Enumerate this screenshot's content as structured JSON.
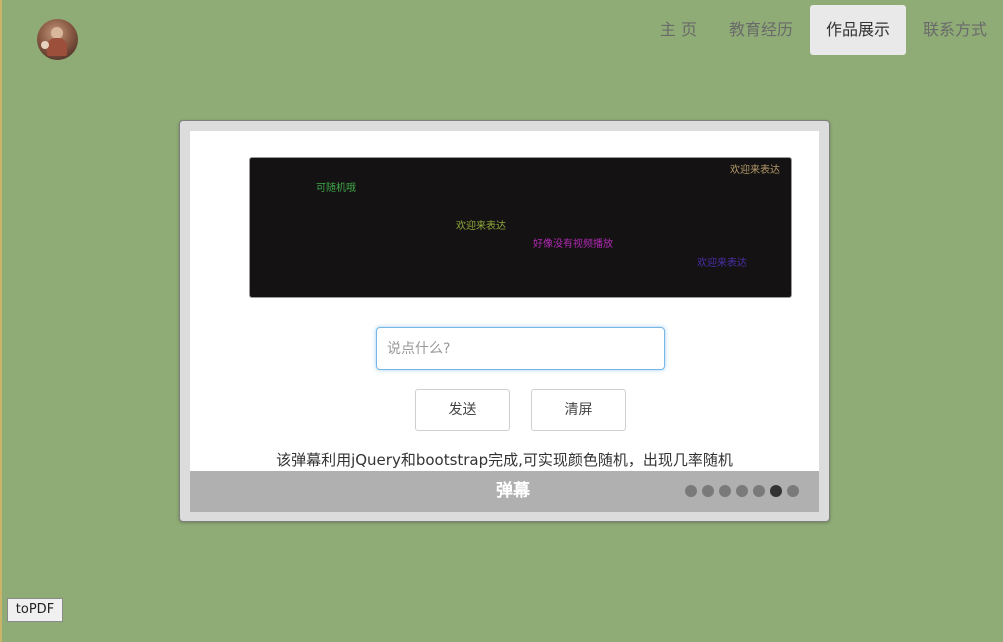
{
  "nav": {
    "items": [
      {
        "label": "主 页",
        "active": false
      },
      {
        "label": "教育经历",
        "active": false
      },
      {
        "label": "作品展示",
        "active": true
      },
      {
        "label": "联系方式",
        "active": false
      }
    ]
  },
  "slide": {
    "danmu": [
      {
        "text": "欢迎来表达",
        "color": "#b59a6a"
      },
      {
        "text": "可随机哦",
        "color": "#3fa84a"
      },
      {
        "text": "欢迎来表达",
        "color": "#8fa83a"
      },
      {
        "text": "好像没有视频播放",
        "color": "#b02ab4"
      },
      {
        "text": "欢迎来表达",
        "color": "#4a2fa8"
      }
    ],
    "input_placeholder": "说点什么?",
    "send_label": "发送",
    "clear_label": "清屏",
    "description": "该弹幕利用jQuery和bootstrap完成,可实现颜色随机，出现几率随机",
    "caption": "弹幕",
    "dots_count": 7,
    "active_dot": 6
  },
  "topdf_label": "toPDF"
}
